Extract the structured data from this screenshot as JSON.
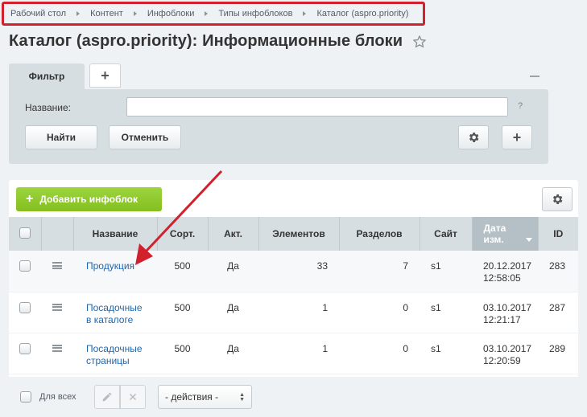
{
  "breadcrumb": [
    "Рабочий стол",
    "Контент",
    "Инфоблоки",
    "Типы инфоблоков",
    "Каталог (aspro.priority)"
  ],
  "page_title": "Каталог (aspro.priority): Информационные блоки",
  "filter": {
    "tab_label": "Фильтр",
    "add_tab": "+",
    "name_label": "Название:",
    "name_value": "",
    "help": "?",
    "find_label": "Найти",
    "cancel_label": "Отменить",
    "plus_label": "+"
  },
  "toolbar": {
    "add_label": "Добавить инфоблок",
    "add_icon": "+"
  },
  "table": {
    "headers": {
      "name": "Название",
      "sort": "Сорт.",
      "active": "Акт.",
      "elements": "Элементов",
      "sections": "Разделов",
      "site": "Сайт",
      "date_line1": "Дата",
      "date_line2": "изм.",
      "id": "ID"
    },
    "rows": [
      {
        "name_line1": "Продукция",
        "name_line2": "",
        "sort": "500",
        "active": "Да",
        "elements": "33",
        "sections": "7",
        "site": "s1",
        "date": "20.12.2017",
        "time": "12:58:05",
        "id": "283"
      },
      {
        "name_line1": "Посадочные",
        "name_line2": "в каталоге",
        "sort": "500",
        "active": "Да",
        "elements": "1",
        "sections": "0",
        "site": "s1",
        "date": "03.10.2017",
        "time": "12:21:17",
        "id": "287"
      },
      {
        "name_line1": "Посадочные",
        "name_line2": "страницы",
        "sort": "500",
        "active": "Да",
        "elements": "1",
        "sections": "0",
        "site": "s1",
        "date": "03.10.2017",
        "time": "12:20:59",
        "id": "289"
      }
    ]
  },
  "footer": {
    "for_all": "Для всех",
    "actions_value": "- действия -"
  },
  "colors": {
    "accent_green": "#8cc63f",
    "link": "#2067b0",
    "highlight_red": "#d0212d"
  }
}
